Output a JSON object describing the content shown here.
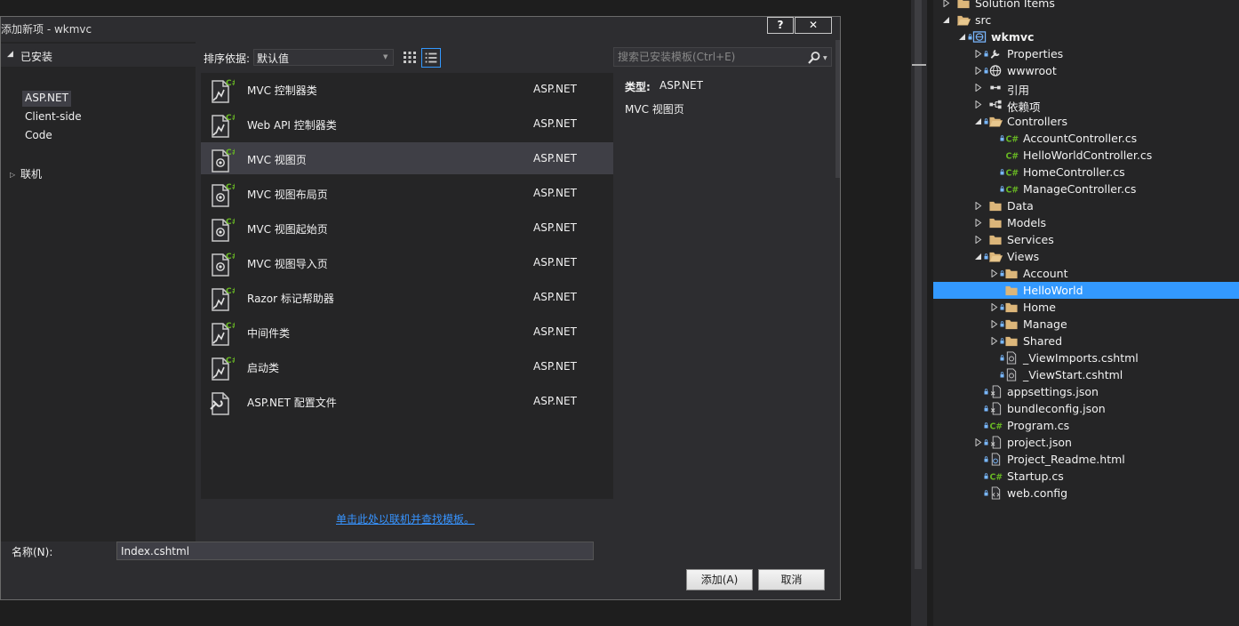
{
  "dialog": {
    "title": "添加新项 - wkmvc",
    "help_label": "?",
    "close_label": "✕",
    "installed_label": "已安装",
    "categories": [
      "ASP.NET",
      "Client-side",
      "Code"
    ],
    "online_label": "联机",
    "sort_label": "排序依据:",
    "sort_value": "默认值",
    "search_placeholder": "搜索已安装模板(Ctrl+E)",
    "templates": [
      {
        "name": "MVC 控制器类",
        "category": "ASP.NET",
        "icon": "csharp-class-icon"
      },
      {
        "name": "Web API 控制器类",
        "category": "ASP.NET",
        "icon": "csharp-class-icon"
      },
      {
        "name": "MVC 视图页",
        "category": "ASP.NET",
        "icon": "razor-view-icon",
        "selected": true
      },
      {
        "name": "MVC 视图布局页",
        "category": "ASP.NET",
        "icon": "razor-view-icon"
      },
      {
        "name": "MVC 视图起始页",
        "category": "ASP.NET",
        "icon": "razor-view-icon"
      },
      {
        "name": "MVC 视图导入页",
        "category": "ASP.NET",
        "icon": "razor-view-icon"
      },
      {
        "name": "Razor 标记帮助器",
        "category": "ASP.NET",
        "icon": "csharp-class-icon"
      },
      {
        "name": "中间件类",
        "category": "ASP.NET",
        "icon": "csharp-class-icon"
      },
      {
        "name": "启动类",
        "category": "ASP.NET",
        "icon": "csharp-class-icon"
      },
      {
        "name": "ASP.NET 配置文件",
        "category": "ASP.NET",
        "icon": "config-file-icon"
      }
    ],
    "detail_type_label": "类型:",
    "detail_type_value": "ASP.NET",
    "detail_description": "MVC 视图页",
    "online_link": "单击此处以联机并查找模板。",
    "name_label": "名称(N):",
    "name_value": "Index.cshtml",
    "add_label": "添加(A)",
    "cancel_label": "取消"
  },
  "solution_explorer": {
    "items": [
      {
        "label": "Solution Items",
        "level": 0,
        "expander": "collapsed",
        "icon": "folder-icon"
      },
      {
        "label": "src",
        "level": 0,
        "expander": "expanded",
        "icon": "folder-open-icon"
      },
      {
        "label": "wkmvc",
        "level": 1,
        "expander": "expanded",
        "icon": "web-project-icon",
        "bold": true,
        "lock": true
      },
      {
        "label": "Properties",
        "level": 2,
        "expander": "collapsed",
        "icon": "wrench-icon",
        "lock": true
      },
      {
        "label": "wwwroot",
        "level": 2,
        "expander": "collapsed",
        "icon": "globe-icon",
        "lock": true
      },
      {
        "label": "引用",
        "level": 2,
        "expander": "collapsed",
        "icon": "references-icon"
      },
      {
        "label": "依赖项",
        "level": 2,
        "expander": "collapsed",
        "icon": "dependencies-icon"
      },
      {
        "label": "Controllers",
        "level": 2,
        "expander": "expanded",
        "icon": "folder-open-icon",
        "lock": true
      },
      {
        "label": "AccountController.cs",
        "level": 3,
        "icon": "csharp-file-icon",
        "lock": true
      },
      {
        "label": "HelloWorldController.cs",
        "level": 3,
        "icon": "csharp-file-icon"
      },
      {
        "label": "HomeController.cs",
        "level": 3,
        "icon": "csharp-file-icon",
        "lock": true
      },
      {
        "label": "ManageController.cs",
        "level": 3,
        "icon": "csharp-file-icon",
        "lock": true
      },
      {
        "label": "Data",
        "level": 2,
        "expander": "collapsed",
        "icon": "folder-icon"
      },
      {
        "label": "Models",
        "level": 2,
        "expander": "collapsed",
        "icon": "folder-icon"
      },
      {
        "label": "Services",
        "level": 2,
        "expander": "collapsed",
        "icon": "folder-icon"
      },
      {
        "label": "Views",
        "level": 2,
        "expander": "expanded",
        "icon": "folder-open-icon",
        "lock": true
      },
      {
        "label": "Account",
        "level": 3,
        "expander": "collapsed",
        "icon": "folder-icon",
        "lock": true
      },
      {
        "label": "HelloWorld",
        "level": 3,
        "icon": "folder-icon",
        "selected": true
      },
      {
        "label": "Home",
        "level": 3,
        "expander": "collapsed",
        "icon": "folder-icon",
        "lock": true
      },
      {
        "label": "Manage",
        "level": 3,
        "expander": "collapsed",
        "icon": "folder-icon",
        "lock": true
      },
      {
        "label": "Shared",
        "level": 3,
        "expander": "collapsed",
        "icon": "folder-icon",
        "lock": true
      },
      {
        "label": "_ViewImports.cshtml",
        "level": 3,
        "icon": "razor-file-icon",
        "lock": true
      },
      {
        "label": "_ViewStart.cshtml",
        "level": 3,
        "icon": "razor-file-icon",
        "lock": true
      },
      {
        "label": "appsettings.json",
        "level": 2,
        "icon": "json-file-icon",
        "lock": true
      },
      {
        "label": "bundleconfig.json",
        "level": 2,
        "icon": "json-file-icon",
        "lock": true
      },
      {
        "label": "Program.cs",
        "level": 2,
        "icon": "csharp-file-icon",
        "lock": true
      },
      {
        "label": "project.json",
        "level": 2,
        "expander": "collapsed",
        "icon": "json-file-icon",
        "lock": true
      },
      {
        "label": "Project_Readme.html",
        "level": 2,
        "icon": "html-file-icon",
        "lock": true
      },
      {
        "label": "Startup.cs",
        "level": 2,
        "icon": "csharp-file-icon",
        "lock": true
      },
      {
        "label": "web.config",
        "level": 2,
        "icon": "config-xml-icon",
        "lock": true
      }
    ]
  },
  "colors": {
    "accent": "#3399ff",
    "selection": "#3f3f46",
    "csharp_badge": "#68b723",
    "link": "#3794ff",
    "folder": "#dcb67a"
  }
}
